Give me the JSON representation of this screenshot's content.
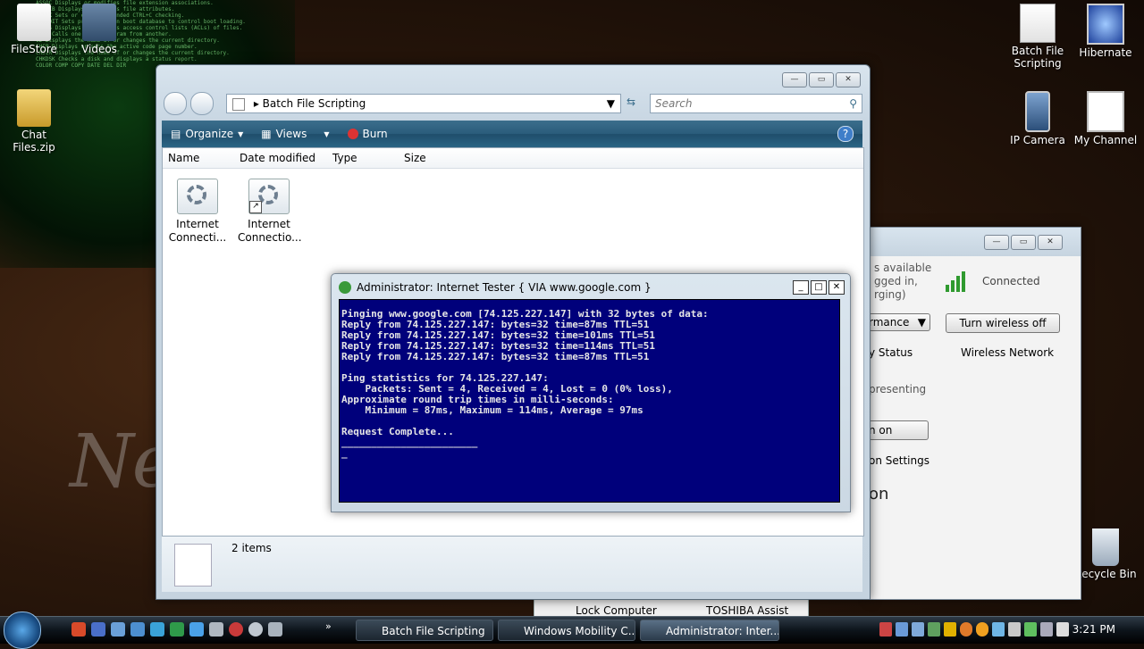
{
  "desktop": {
    "icons": [
      {
        "label": "FileStore"
      },
      {
        "label": "Videos"
      },
      {
        "label": "Chat Files.zip"
      },
      {
        "label": "Batch File Scripting"
      },
      {
        "label": "Hibernate"
      },
      {
        "label": "IP Camera"
      },
      {
        "label": "My Channel"
      },
      {
        "label": "Recycle Bin"
      }
    ],
    "wallpaper_text": "Ner"
  },
  "explorer": {
    "address": "Batch File Scripting",
    "search_placeholder": "Search",
    "toolbar": {
      "organize": "Organize",
      "views": "Views",
      "burn": "Burn"
    },
    "columns": [
      "Name",
      "Date modified",
      "Type",
      "Size"
    ],
    "files": [
      {
        "label_line1": "Internet",
        "label_line2": "Connecti..."
      },
      {
        "label_line1": "Internet",
        "label_line2": "Connectio..."
      }
    ],
    "status": "2 items"
  },
  "console": {
    "title": "Administrator:  Internet Tester { VIA www.google.com }",
    "lines": [
      "Pinging www.google.com [74.125.227.147] with 32 bytes of data:",
      "Reply from 74.125.227.147: bytes=32 time=87ms TTL=51",
      "Reply from 74.125.227.147: bytes=32 time=101ms TTL=51",
      "Reply from 74.125.227.147: bytes=32 time=114ms TTL=51",
      "Reply from 74.125.227.147: bytes=32 time=87ms TTL=51",
      "",
      "Ping statistics for 74.125.227.147:",
      "    Packets: Sent = 4, Received = 4, Lost = 0 (0% loss),",
      "Approximate round trip times in milli-seconds:",
      "    Minimum = 87ms, Maximum = 114ms, Average = 97ms",
      "",
      "Request Complete...",
      "_______________________",
      "_"
    ]
  },
  "mobility": {
    "battery_text1": "s available",
    "battery_text2": "gged in,",
    "battery_text3": "rging)",
    "power_select": "rmance",
    "battery_status": "y Status",
    "wireless_status": "Connected",
    "wireless_button": "Turn wireless off",
    "wireless_label": "Wireless Network",
    "presenting_text": "presenting",
    "presenting_button": "n on",
    "presentation_settings": "on Settings",
    "large_text": "on",
    "lock_computer": "Lock Computer",
    "toshiba_assist": "TOSHIBA Assist"
  },
  "taskbar": {
    "tasks": [
      {
        "label": "Batch File Scripting"
      },
      {
        "label": "Windows Mobility C..."
      },
      {
        "label": "Administrator:  Inter..."
      }
    ],
    "clock": "3:21 PM"
  }
}
